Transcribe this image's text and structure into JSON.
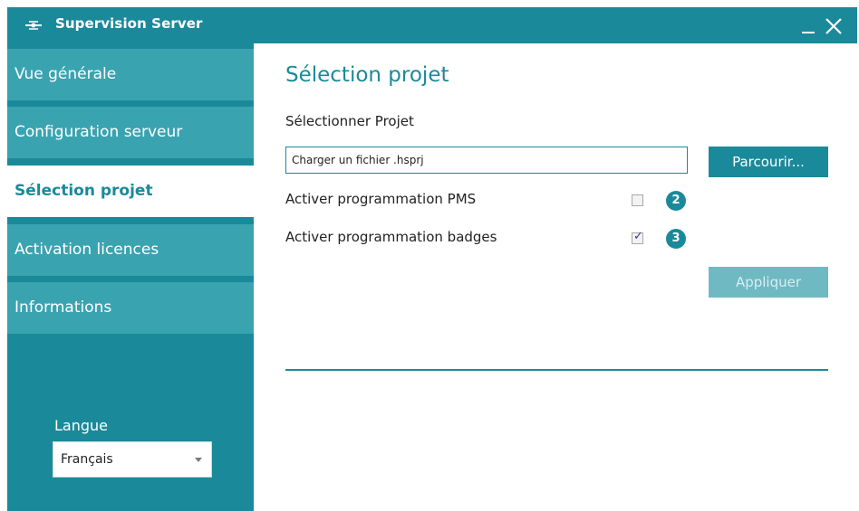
{
  "window": {
    "title": "Supervision Server",
    "minimize_icon": "minimize-icon",
    "close_icon": "close-icon",
    "app_icon": "supervision-app-icon"
  },
  "sidebar": {
    "items": [
      {
        "label": "Vue générale",
        "active": false
      },
      {
        "label": "Configuration serveur",
        "active": false
      },
      {
        "label": "Sélection projet",
        "active": true
      },
      {
        "label": "Activation licences",
        "active": false
      },
      {
        "label": "Informations",
        "active": false
      }
    ],
    "language": {
      "label": "Langue",
      "selected": "Français"
    }
  },
  "main": {
    "title": "Sélection projet",
    "select_project_label": "Sélectionner Projet",
    "file_input": {
      "value": "Charger un fichier .hsprj",
      "placeholder": ""
    },
    "browse_label": "Parcourir...",
    "options": [
      {
        "label": "Activer programmation PMS",
        "checked": false,
        "badge": "2"
      },
      {
        "label": "Activer programmation badges",
        "checked": true,
        "badge": "3"
      }
    ],
    "apply_label": "Appliquer"
  },
  "colors": {
    "brand": "#1a8a9a",
    "nav_item": "#3aa3b0",
    "apply_disabled": "#6fb9c3"
  }
}
